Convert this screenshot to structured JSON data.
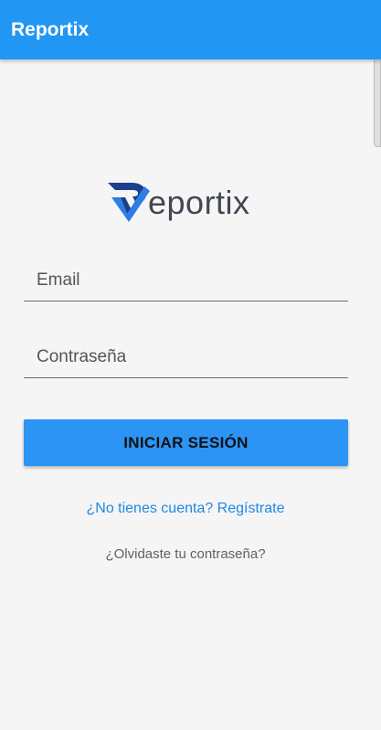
{
  "app_bar": {
    "title": "Reportix"
  },
  "logo": {
    "icon": "reportix-logo-icon",
    "wordmark": "eportix",
    "colors": {
      "dark_blue": "#1c3f8c",
      "light_blue": "#2e7de6",
      "text": "#424753"
    }
  },
  "form": {
    "email_placeholder": "Email",
    "email_value": "",
    "password_placeholder": "Contraseña",
    "password_value": "",
    "submit_label": "INICIAR SESIÓN"
  },
  "links": {
    "register": "¿No tienes cuenta? Regístrate",
    "forgot_password": "¿Olvidaste tu contraseña?"
  },
  "colors": {
    "primary": "#2196f3",
    "button": "#2b94f5",
    "link": "#1e88e5",
    "background": "#f5f5f5"
  }
}
